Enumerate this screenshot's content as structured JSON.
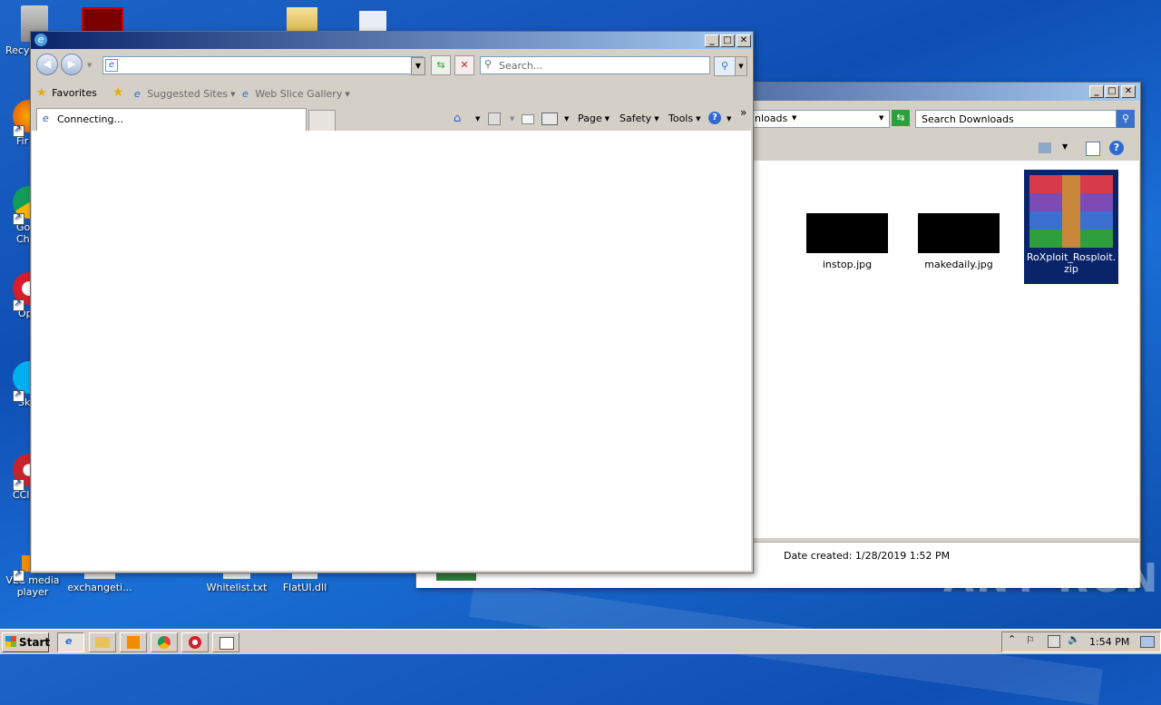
{
  "desktop": {
    "icons": [
      {
        "label": "Recy",
        "name": "recycle-bin"
      },
      {
        "label": "Fir",
        "name": "firefox"
      },
      {
        "label": "Go\nChr",
        "name": "google-chrome"
      },
      {
        "label": "Op",
        "name": "opera"
      },
      {
        "label": "Sk",
        "name": "skype"
      },
      {
        "label": "CCle",
        "name": "ccleaner"
      },
      {
        "label": "VLC media\nplayer",
        "name": "vlc"
      },
      {
        "label": "exchangeti...",
        "name": "exchange-file"
      },
      {
        "label": "Whitelist.txt",
        "name": "whitelist-txt"
      },
      {
        "label": "FlatUI.dll",
        "name": "flatui-dll"
      }
    ],
    "watermark": "ANY RUN"
  },
  "explorer": {
    "address_tail": "nloads",
    "search_placeholder": "Search Downloads",
    "files": [
      {
        "name": "instop.jpg"
      },
      {
        "name": "makedaily.jpg"
      },
      {
        "name": "RoXploit_Rosploit.zip"
      }
    ],
    "status": "Date created: 1/28/2019 1:52 PM"
  },
  "ie": {
    "address_value": "",
    "search_placeholder": "Search...",
    "favorites_label": "Favorites",
    "suggested_label": "Suggested Sites",
    "webslice_label": "Web Slice Gallery",
    "tab_label": "Connecting...",
    "cmd": {
      "page": "Page",
      "safety": "Safety",
      "tools": "Tools"
    },
    "chevron": "»"
  },
  "taskbar": {
    "start_label": "Start",
    "clock": "1:54 PM"
  },
  "colors": {
    "desktop_blue": "#1a5fc4",
    "title_grad_start": "#0a246a",
    "title_grad_end": "#a6caf0",
    "selection": "#0a246a"
  }
}
